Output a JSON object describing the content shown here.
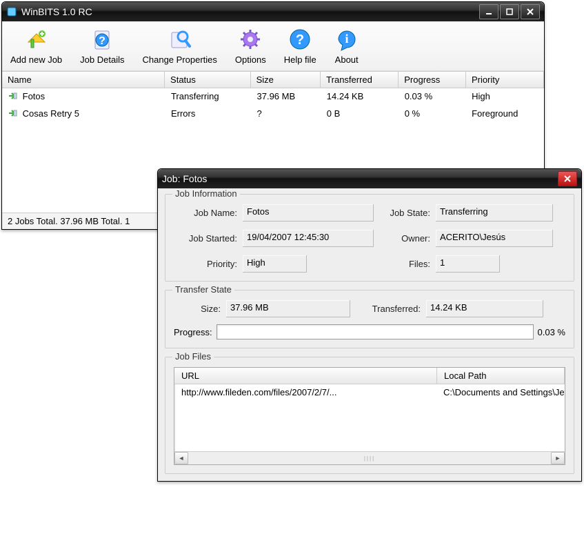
{
  "mainWindow": {
    "title": "WinBITS 1.0 RC",
    "toolbar": {
      "addJob": "Add new Job",
      "jobDetails": "Job Details",
      "changeProps": "Change Properties",
      "options": "Options",
      "helpFile": "Help file",
      "about": "About"
    },
    "columns": {
      "name": "Name",
      "status": "Status",
      "size": "Size",
      "transferred": "Transferred",
      "progress": "Progress",
      "priority": "Priority"
    },
    "rows": [
      {
        "name": "Fotos",
        "status": "Transferring",
        "size": "37.96 MB",
        "transferred": "14.24 KB",
        "progress": "0.03 %",
        "priority": "High"
      },
      {
        "name": "Cosas Retry 5",
        "status": "Errors",
        "size": "?",
        "transferred": "0 B",
        "progress": "0 %",
        "priority": "Foreground"
      }
    ],
    "statusbar": "2 Jobs Total. 37.96 MB Total. 1"
  },
  "dialog": {
    "title": "Job: Fotos",
    "groups": {
      "info": "Job Information",
      "transfer": "Transfer State",
      "files": "Job Files"
    },
    "info": {
      "jobNameLabel": "Job Name:",
      "jobName": "Fotos",
      "jobStateLabel": "Job State:",
      "jobState": "Transferring",
      "jobStartedLabel": "Job Started:",
      "jobStarted": "19/04/2007 12:45:30",
      "ownerLabel": "Owner:",
      "owner": "ACERITO\\Jesús",
      "priorityLabel": "Priority:",
      "priority": "High",
      "filesLabel": "Files:",
      "files": "1"
    },
    "transfer": {
      "sizeLabel": "Size:",
      "size": "37.96 MB",
      "transferredLabel": "Transferred:",
      "transferred": "14.24 KB",
      "progressLabel": "Progress:",
      "progressText": "0.03 %"
    },
    "filesTable": {
      "urlHeader": "URL",
      "pathHeader": "Local Path",
      "row": {
        "url": "http://www.fileden.com/files/2007/2/7/...",
        "path": "C:\\Documents and Settings\\Je"
      }
    }
  }
}
